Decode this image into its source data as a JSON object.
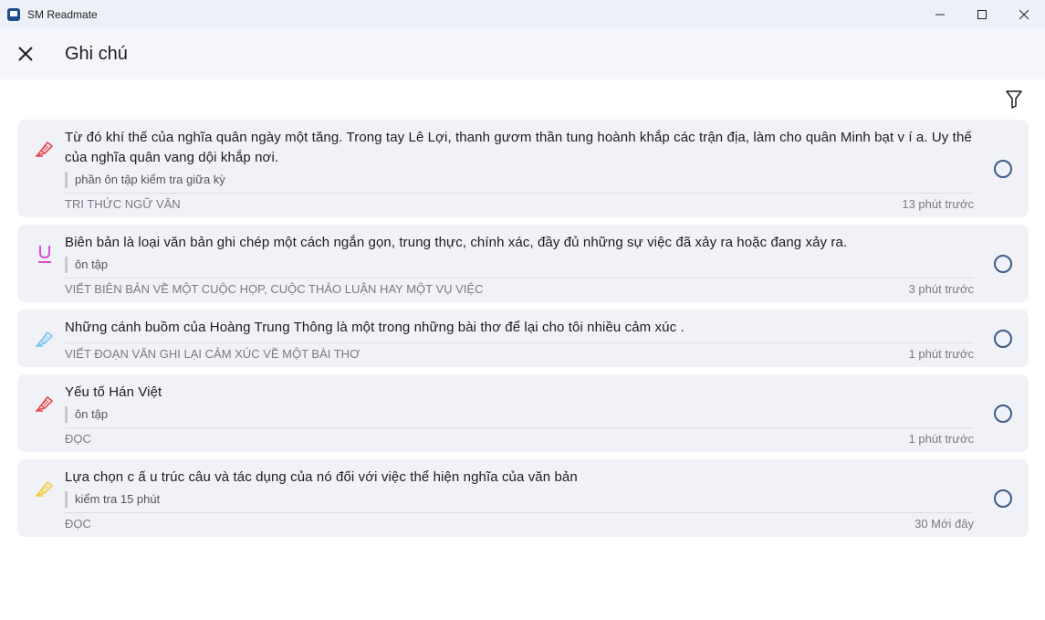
{
  "window": {
    "title": "SM Readmate"
  },
  "header": {
    "title": "Ghi chú"
  },
  "notes": [
    {
      "icon": "highlighter-red-icon",
      "color": "#e5484d",
      "text": "Từ đó khí thế của nghĩa quân ngày một tăng. Trong tay Lê Lợi, thanh gươm thần tung hoành khắp các trận địa, làm cho quân Minh bạt v í a. Uy thế của nghĩa quân vang dội khắp nơi.",
      "note": "phần ôn tập kiểm tra giữa kỳ",
      "chapter": "TRI THỨC NGỮ VĂN",
      "time": "13 phút trước"
    },
    {
      "icon": "underline-icon",
      "color": "#d94fd3",
      "text": "Biên bản là loại văn bản ghi chép một cách ngắn gọn, trung thực, chính xác, đầy đủ những sự việc đã xảy ra hoặc đang xảy ra.",
      "note": "ôn tập",
      "chapter": "VIẾT BIÊN BẢN VỀ MỘT CUỘC HỌP, CUỘC THẢO LUẬN HAY MỘT VỤ VIỆC",
      "time": "3 phút trước"
    },
    {
      "icon": "highlighter-blue-icon",
      "color": "#7cc4ef",
      "text": "Những cánh buồm của Hoàng Trung Thông là một trong những bài thơ để lại cho tôi nhiều cảm xúc .",
      "note": "",
      "chapter": "VIẾT ĐOẠN VĂN GHI LẠI CẢM XÚC VỀ MỘT BÀI THƠ",
      "time": "1 phút trước"
    },
    {
      "icon": "highlighter-red-icon",
      "color": "#e5484d",
      "text": "Yếu tố Hán Việt",
      "note": "ôn tập",
      "chapter": "ĐỌC",
      "time": "1 phút trước"
    },
    {
      "icon": "highlighter-yellow-icon",
      "color": "#f2cc3a",
      "text": "Lựa chọn c ấ u trúc câu và tác dụng của nó đối với việc thể hiện nghĩa của văn bản",
      "note": "kiểm tra 15 phút",
      "chapter": "ĐỌC",
      "time": "30 Mới đây"
    }
  ]
}
